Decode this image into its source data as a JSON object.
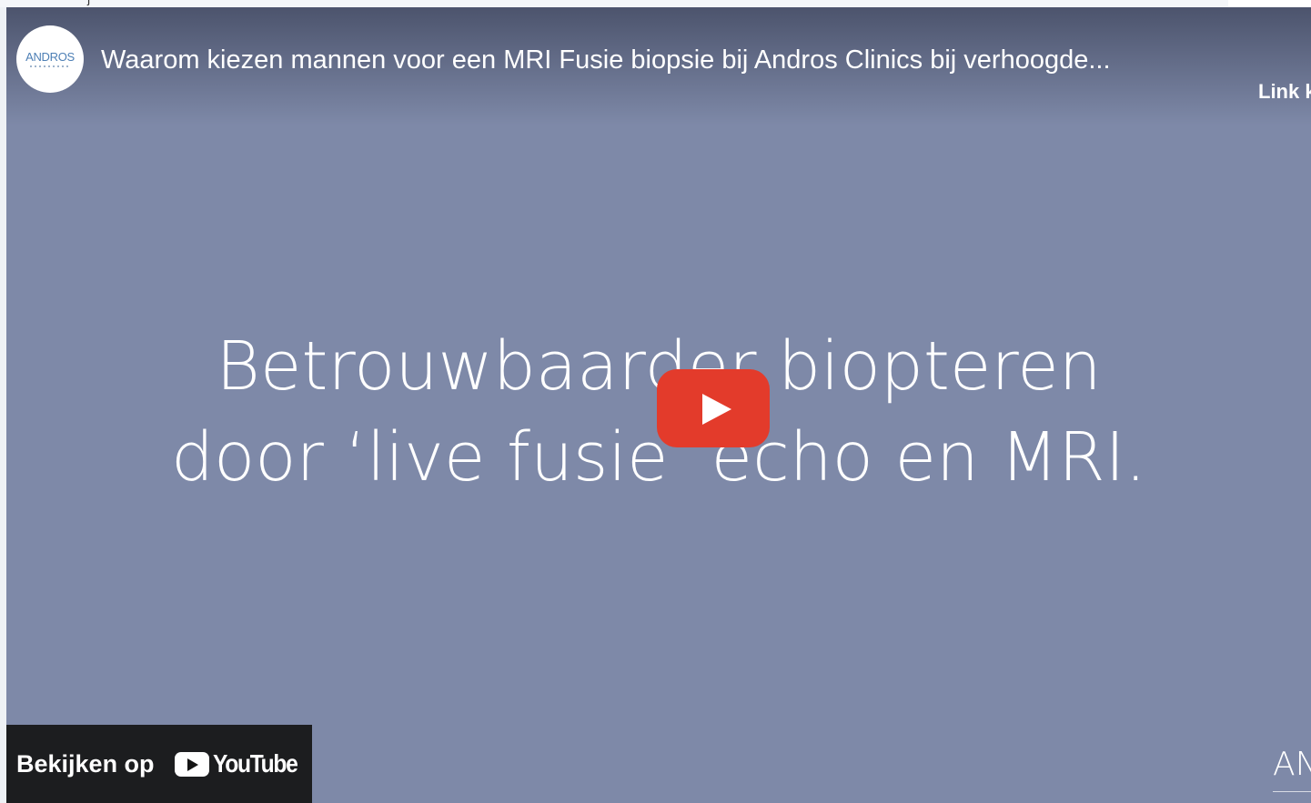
{
  "page": {
    "clipped_text": "j"
  },
  "player": {
    "channel": {
      "logo_text": "ANDROS"
    },
    "title": "Waarom kiezen mannen voor een MRI Fusie biopsie bij Andros Clinics bij verhoogde...",
    "copy_link_label": "Link k",
    "slide": {
      "line1": "Betrouwbaarder biopteren",
      "line2": "door ‘live fusie’ echo en MRI."
    },
    "watch_on": {
      "label": "Bekijken op",
      "brand": "YouTube"
    },
    "watermark": "AN"
  },
  "colors": {
    "player_background": "#7e89a8",
    "play_button": "#e33b2b",
    "logo_blue": "#4d7fb5"
  },
  "icons": {
    "play": "play-icon",
    "youtube": "youtube-logo-icon"
  }
}
